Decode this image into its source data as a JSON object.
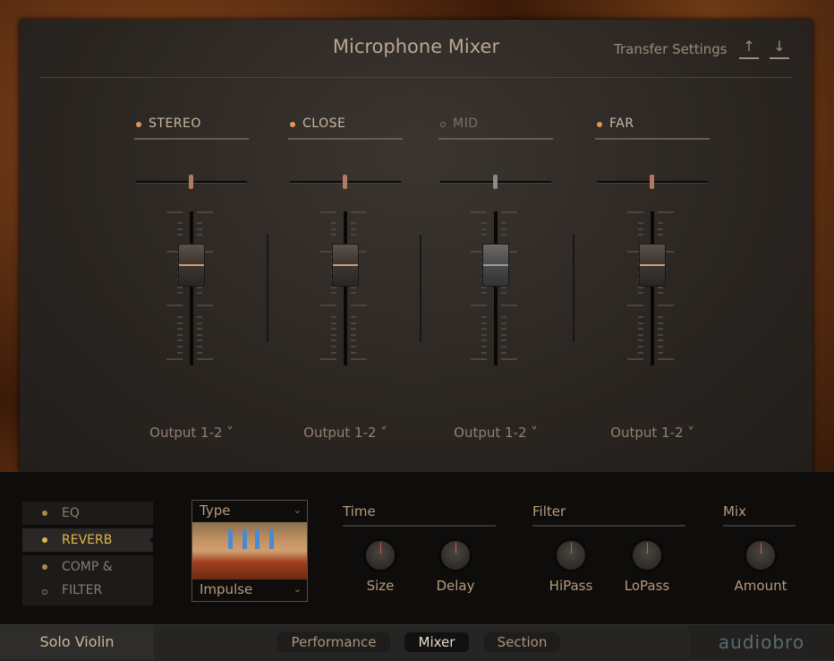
{
  "header": {
    "title": "Microphone Mixer",
    "transfer_label": "Transfer Settings",
    "upload_icon": "upload-icon",
    "download_icon": "download-icon"
  },
  "channels": [
    {
      "name": "STEREO",
      "enabled": true,
      "output": "Output 1-2 ˅",
      "pan": 0.5,
      "level": 0.65
    },
    {
      "name": "CLOSE",
      "enabled": true,
      "output": "Output 1-2 ˅",
      "pan": 0.5,
      "level": 0.65
    },
    {
      "name": "MID",
      "enabled": false,
      "output": "Output 1-2 ˅",
      "pan": 0.5,
      "level": 0.65
    },
    {
      "name": "FAR",
      "enabled": true,
      "output": "Output 1-2 ˅",
      "pan": 0.5,
      "level": 0.65
    }
  ],
  "effects": {
    "tabs": [
      {
        "label": "EQ"
      },
      {
        "label": "REVERB",
        "active": true
      },
      {
        "label": "COMP &"
      },
      {
        "label": "FILTER"
      }
    ],
    "type_label": "Type",
    "impulse_label": "Impulse",
    "groups": {
      "time": "Time",
      "filter": "Filter",
      "mix": "Mix"
    },
    "knobs": {
      "size": "Size",
      "delay": "Delay",
      "hipass": "HiPass",
      "lopass": "LoPass",
      "amount": "Amount"
    }
  },
  "footer": {
    "instrument": "Solo Violin",
    "tabs": [
      "Performance",
      "Mixer",
      "Section"
    ],
    "active_tab": "Mixer",
    "logo": "audiobro"
  },
  "colors": {
    "accent": "#e0965a",
    "active_tab": "#e3b54a"
  }
}
